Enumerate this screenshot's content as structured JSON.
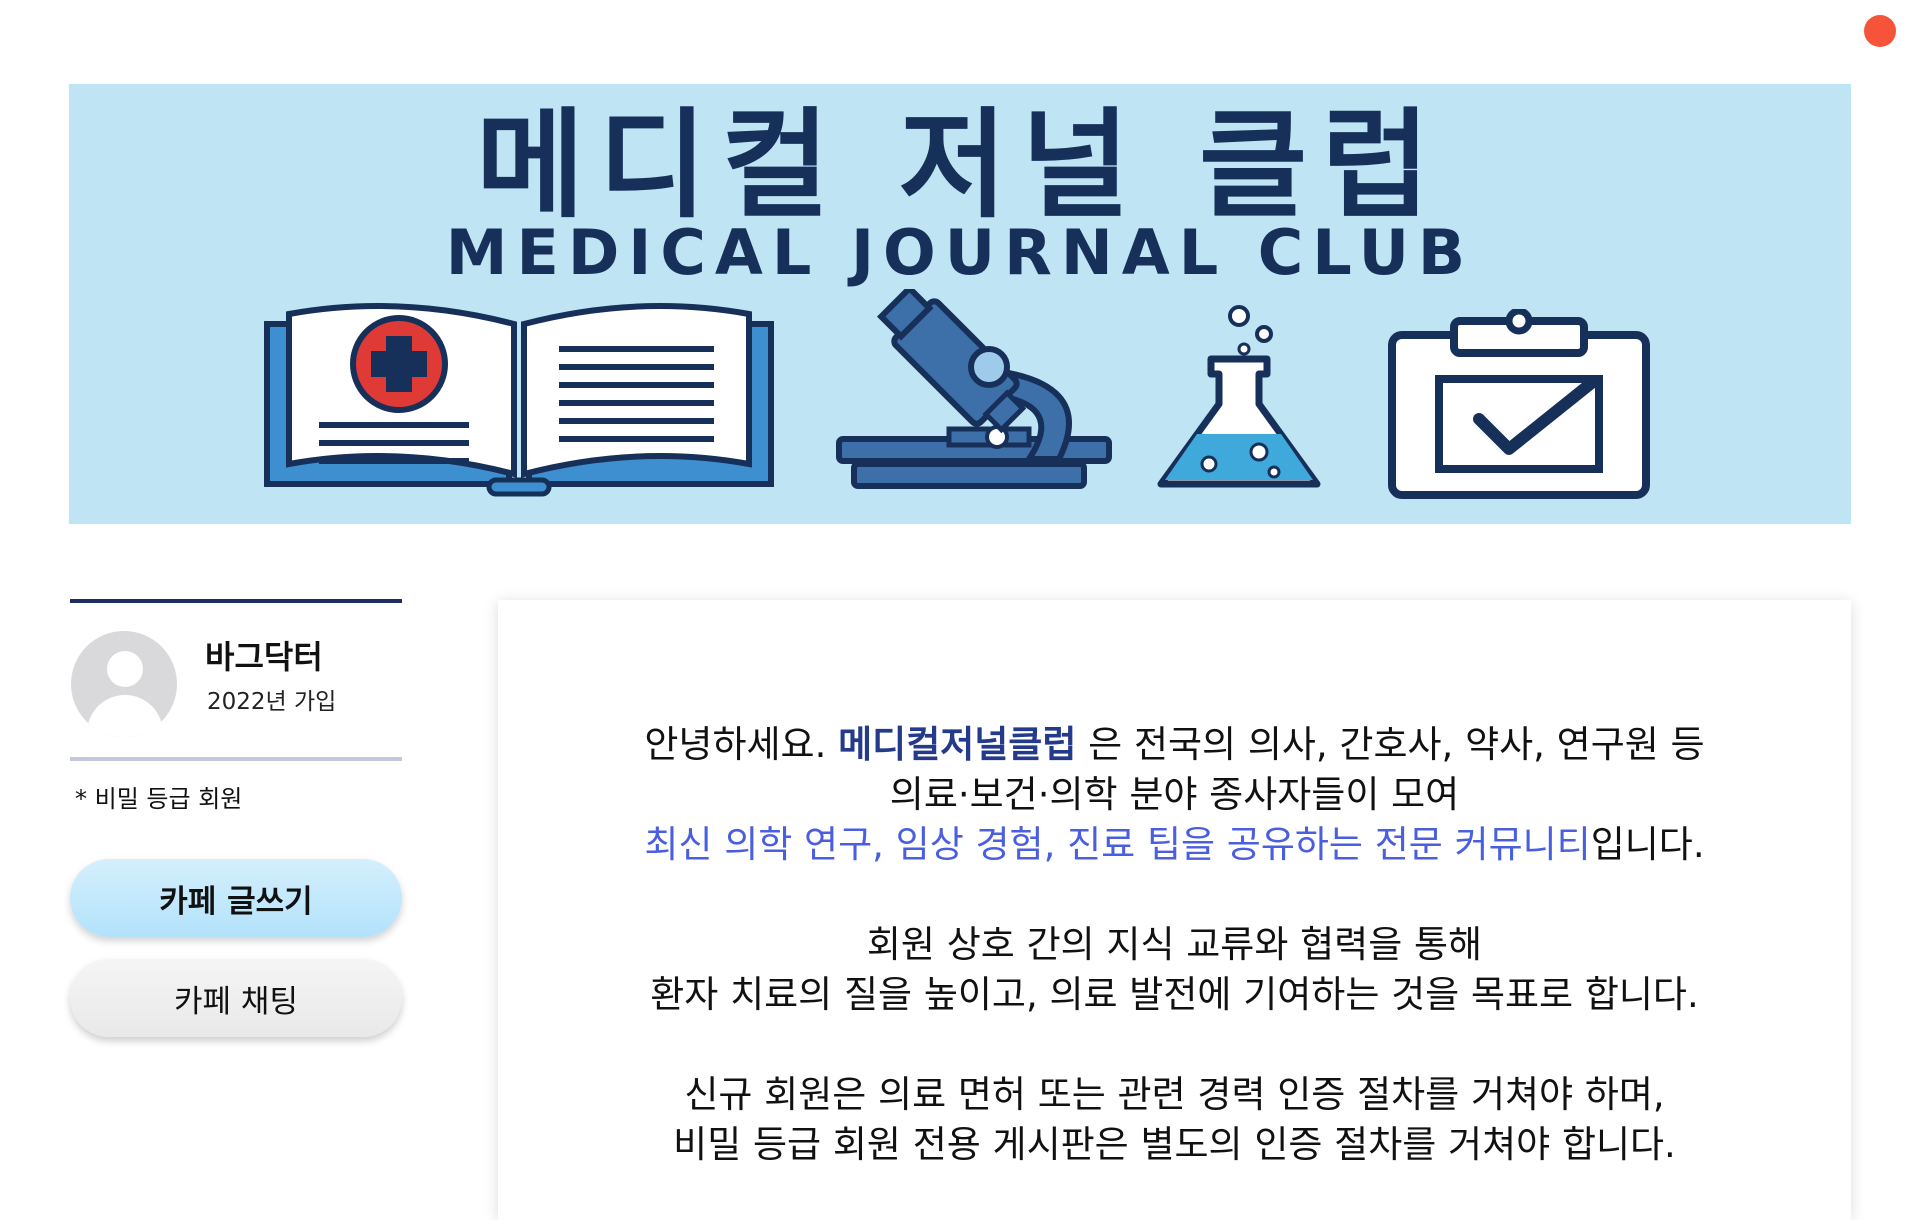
{
  "colors": {
    "banner_bg": "#bfe4f4",
    "banner_text": "#17305a",
    "club_name": "#243a8a",
    "highlight": "#4a5ee0",
    "notification": "#f5543a",
    "write_button": "#b3e2fb"
  },
  "banner": {
    "title": "메디컬 저널 클럽",
    "subtitle": "MEDICAL JOURNAL CLUB",
    "icons": [
      "open-book-medical-cross-icon",
      "microscope-icon",
      "flask-icon",
      "clipboard-check-icon"
    ]
  },
  "profile": {
    "username": "바그닥터",
    "join_date": "2022년 가입",
    "grade": "* 비밀 등급 회원"
  },
  "buttons": {
    "write": "카페 글쓰기",
    "chat": "카페 채팅"
  },
  "intro": {
    "p1_prefix": "안녕하세요. ",
    "p1_club": "메디컬저널클럽",
    "p1_suffix": " 은 전국의 의사, 간호사, 약사, 연구원 등",
    "p1_line2": "의료·보건·의학 분야 종사자들이 모여",
    "p1_highlight": "최신 의학 연구, 임상 경험, 진료 팁을 공유하는 전문 커뮤니티",
    "p1_end": "입니다.",
    "p2_line1": "회원 상호 간의 지식 교류와 협력을 통해",
    "p2_line2": "환자 치료의 질을 높이고, 의료 발전에 기여하는 것을 목표로 합니다.",
    "p3_line1": "신규 회원은 의료 면허 또는 관련 경력 인증 절차를 거쳐야 하며,",
    "p3_line2": "비밀 등급 회원 전용 게시판은 별도의 인증 절차를 거쳐야 합니다."
  }
}
